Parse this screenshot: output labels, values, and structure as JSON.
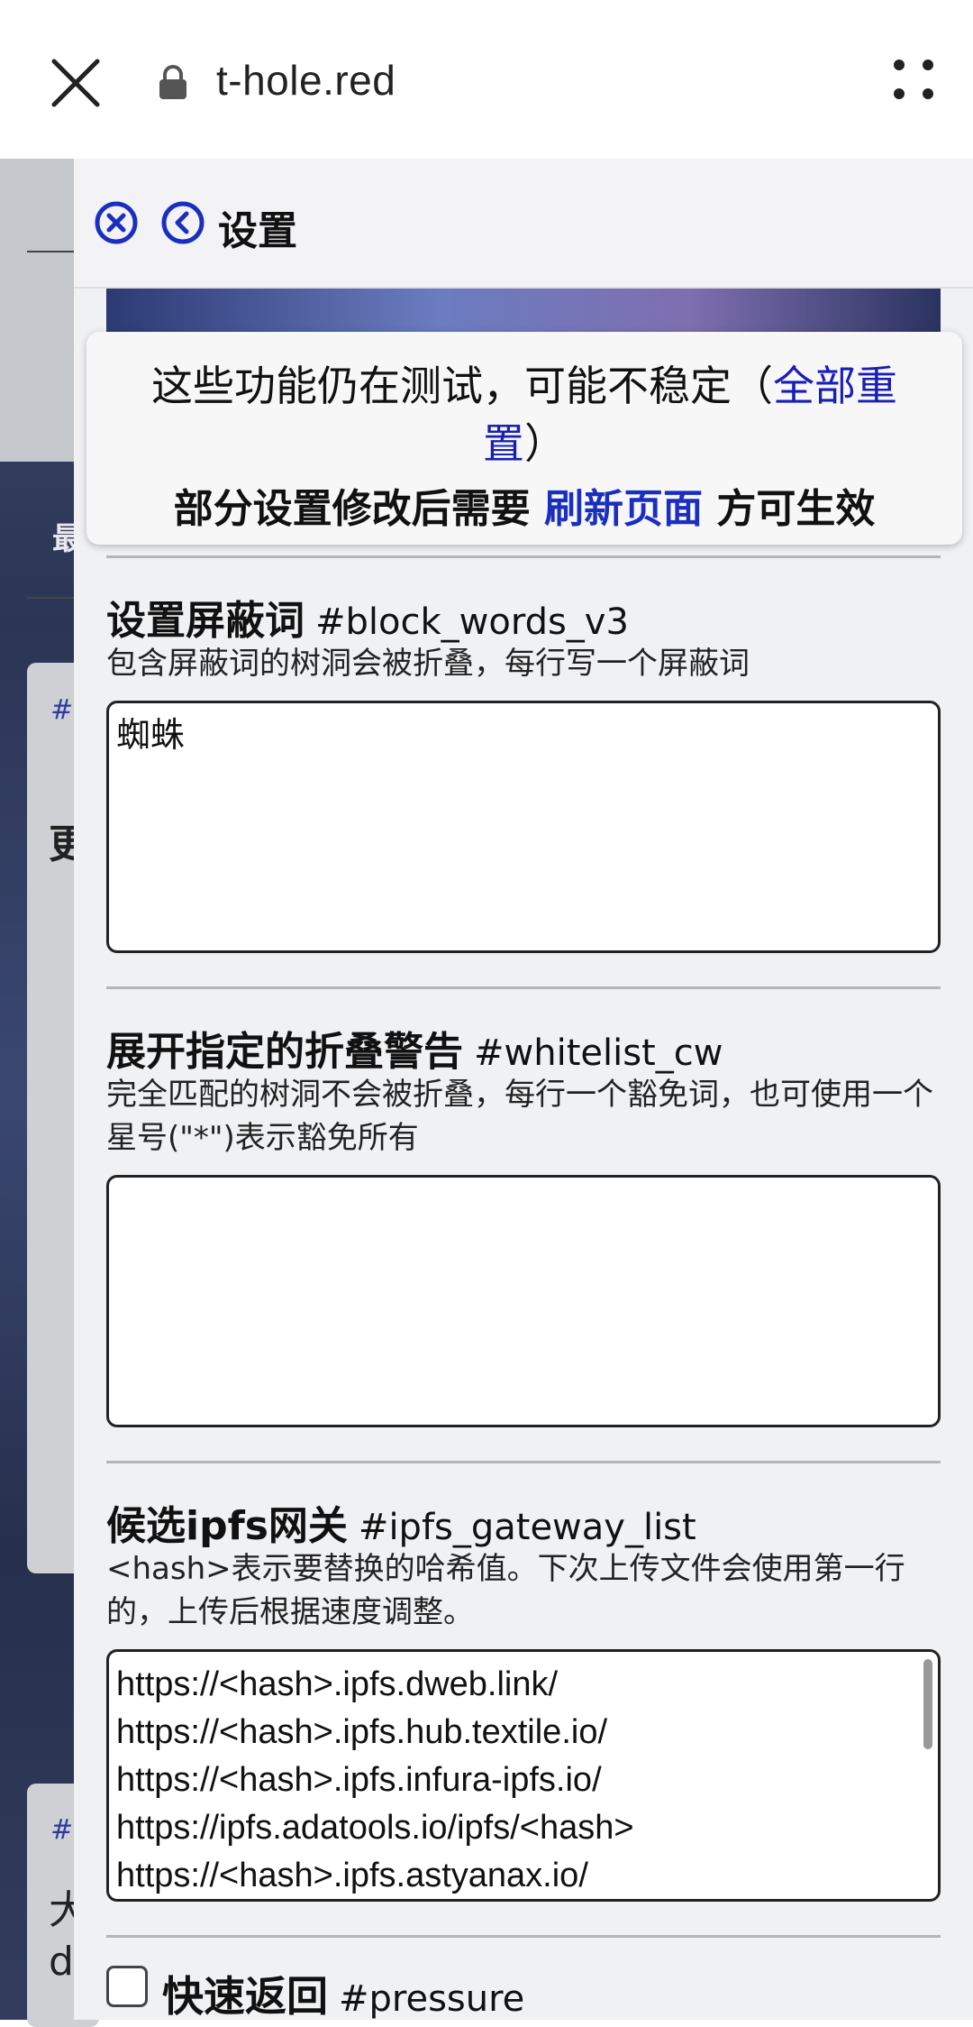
{
  "browser": {
    "url": "t-hole.red",
    "close_icon": "close-icon",
    "lock_icon": "lock-icon",
    "more_icon": "more-icon"
  },
  "background_page": {
    "hash_1": "#",
    "char_1": "更",
    "hash_2": "#",
    "char_2": "大",
    "char_3": "d",
    "sidebar_char": "最"
  },
  "settings": {
    "title": "设置",
    "notice": {
      "text_prefix": "这些功能仍在测试，可能不稳定（",
      "reset_link": "全部重置",
      "text_suffix": "）",
      "line2_prefix": "部分设置修改后需要",
      "refresh_link": "刷新页面",
      "line2_suffix": "方可生效"
    },
    "block_words": {
      "title": "设置屏蔽词",
      "tag": "#block_words_v3",
      "description": "包含屏蔽词的树洞会被折叠，每行写一个屏蔽词",
      "value": "蜘蛛"
    },
    "whitelist_cw": {
      "title": "展开指定的折叠警告",
      "tag": "#whitelist_cw",
      "description": "完全匹配的树洞不会被折叠，每行一个豁免词，也可使用一个星号(\"*\")表示豁免所有",
      "value": ""
    },
    "ipfs_gateway": {
      "title": "候选ipfs网关",
      "tag": "#ipfs_gateway_list",
      "description": "<hash>表示要替换的哈希值。下次上传文件会使用第一行的，上传后根据速度调整。",
      "lines": [
        "https://<hash>.ipfs.dweb.link/",
        "https://<hash>.ipfs.hub.textile.io/",
        "https://<hash>.ipfs.infura-ipfs.io/",
        "https://ipfs.adatools.io/ipfs/<hash>",
        "https://<hash>.ipfs.astyanax.io/"
      ]
    },
    "pressure": {
      "title": "快速返回",
      "tag": "#pressure",
      "checked": false
    }
  }
}
